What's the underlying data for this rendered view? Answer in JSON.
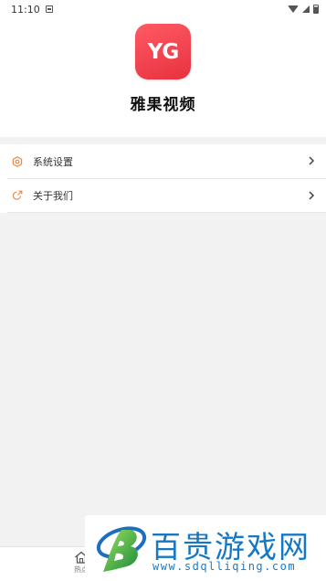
{
  "status_bar": {
    "time": "11:10"
  },
  "app": {
    "icon_text": "YG",
    "name": "雅果视频",
    "icon_color": "#f0424e"
  },
  "menu": {
    "items": [
      {
        "label": "系统设置",
        "icon": "settings-icon"
      },
      {
        "label": "关于我们",
        "icon": "external-link-icon"
      }
    ]
  },
  "bottom_nav": {
    "home_label": "热点"
  },
  "watermark": {
    "title": "百贵游戏网",
    "url": "www.sdqlliqing.com",
    "color": "#1578c4"
  }
}
